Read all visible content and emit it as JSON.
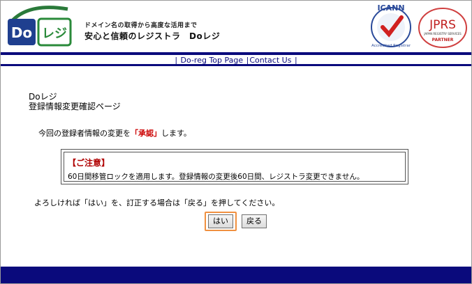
{
  "header": {
    "logo_text_do": "Do",
    "logo_text_reji": "レジ",
    "tagline": "ドメイン名の取得から高度な活用まで",
    "brandline": "安心と信頼のレジストラ　Doレジ",
    "icann_text": "ICANN",
    "icann_sub": "Accredited Registrar",
    "jprs_text": "JPRS",
    "jprs_sub": "JAPAN REGISTRY SERVICES",
    "jprs_partner": "PARTNER"
  },
  "nav": {
    "sep": "|",
    "top_page": "Do-reg Top Page",
    "contact": "Contact Us"
  },
  "page": {
    "heading_line1": "Doレジ",
    "heading_line2": "登録情報変更確認ページ",
    "intro_before": "今回の登録者情報の変更を",
    "intro_em": "「承認」",
    "intro_after": "します。",
    "notice_title": "【ご注意】",
    "notice_body": "60日間移管ロックを適用します。登録情報の変更後60日間、レジストラ変更できません。",
    "confirm_text": "よろしければ「はい」を、訂正する場合は「戻る」を押してください。"
  },
  "buttons": {
    "yes": "はい",
    "back": "戻る"
  },
  "colors": {
    "navy": "#0a0a7c",
    "alert_red": "#cc0000",
    "focus_orange": "#f09040"
  }
}
